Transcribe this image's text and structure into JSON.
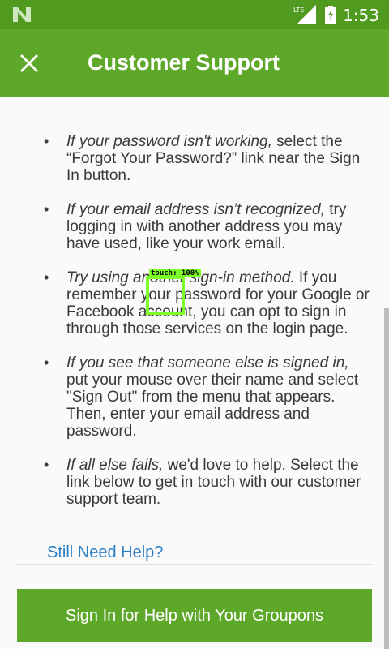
{
  "status_bar": {
    "time": "1:53",
    "network": "LTE",
    "colors": {
      "background": "#4f9a1f"
    }
  },
  "app_bar": {
    "title": "Customer Support",
    "close_icon": "close-icon",
    "background": "#5ea829"
  },
  "content": {
    "tips": [
      {
        "emphasis": "If your password isn't working,",
        "text": " select the “Forgot Your Password?” link near the Sign In button."
      },
      {
        "emphasis": "If your email address isn’t recognized,",
        "text": " try logging in with another address you may have used, like your work email."
      },
      {
        "emphasis": "Try using another sign-in method.",
        "text": " If you remember your password for your Google or Facebook account, you can opt to sign in through those services on the login page."
      },
      {
        "emphasis": "If you see that someone else is signed in,",
        "text": " put your mouse over their name and select \"Sign Out\" from the menu that appears. Then, enter your email address and password."
      },
      {
        "emphasis": "If all else fails,",
        "text": " we'd love to help. Select the link below to get in touch with our customer support team."
      }
    ],
    "help_link": "Still Need Help?",
    "cta_button": "Sign In for Help with Your Groupons"
  },
  "overlay": {
    "touch_label": "touch: 100%"
  }
}
